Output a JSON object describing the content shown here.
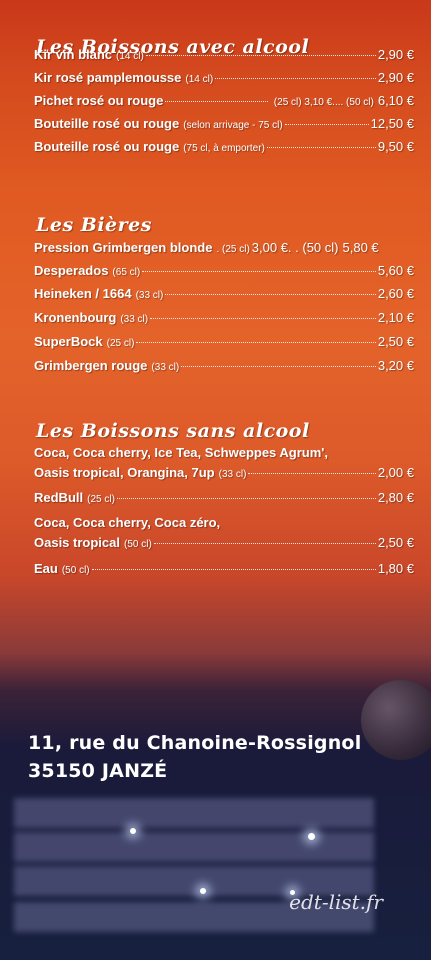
{
  "sections": {
    "alcohol": {
      "title": "Les Boissons avec alcool",
      "rows": [
        {
          "name": "Kir vin blanc",
          "size": "(14 cl)",
          "price": "2,90 €"
        },
        {
          "name": "Kir rosé pamplemousse",
          "size": "(14 cl)",
          "price": "2,90 €"
        },
        {
          "name": "Pichet rosé ou rouge",
          "size": "(25 cl) 3,10 €.... (50 cl)",
          "price": "6,10 €"
        },
        {
          "name": "Bouteille rosé ou rouge",
          "size": "(selon arrivage - 75 cl)",
          "price": "12,50 €"
        },
        {
          "name": "Bouteille rosé ou rouge",
          "size": "(75 cl, à emporter)",
          "price": "9,50 €"
        }
      ]
    },
    "beers": {
      "title": "Les Bières",
      "rows": [
        {
          "name": "Pression Grimbergen blonde",
          "size": ". (25 cl)",
          "mid": "3,00 €. . (50 cl)",
          "price": "5,80 €"
        },
        {
          "name": "Desperados",
          "size": "(65 cl)",
          "price": "5,60 €"
        },
        {
          "name": "Heineken / 1664",
          "size": "(33 cl)",
          "price": "2,60 €"
        },
        {
          "name": "Kronenbourg",
          "size": "(33 cl)",
          "price": "2,10 €"
        },
        {
          "name": "SuperBock",
          "size": "(25 cl)",
          "price": "2,50 €"
        },
        {
          "name": "Grimbergen rouge",
          "size": "(33 cl)",
          "price": "3,20 €"
        }
      ]
    },
    "soft": {
      "title": "Les Boissons sans alcool",
      "line1": "Coca, Coca cherry, Ice Tea, Schweppes Agrum',",
      "row1": {
        "name": "Oasis tropical, Orangina, 7up",
        "size": "(33 cl)",
        "price": "2,00 €"
      },
      "row2": {
        "name": "RedBull",
        "size": "(25 cl)",
        "price": "2,80 €"
      },
      "line2": "Coca, Coca cherry, Coca zéro,",
      "row3": {
        "name": "Oasis tropical",
        "size": "(50 cl)",
        "price": "2,50 €"
      },
      "row4": {
        "name": "Eau",
        "size": "(50 cl)",
        "price": "1,80 €"
      }
    }
  },
  "address": {
    "line1": "11, rue du Chanoine-Rossignol",
    "line2": "35150 JANZÉ"
  },
  "watermark": "edt-list.fr"
}
